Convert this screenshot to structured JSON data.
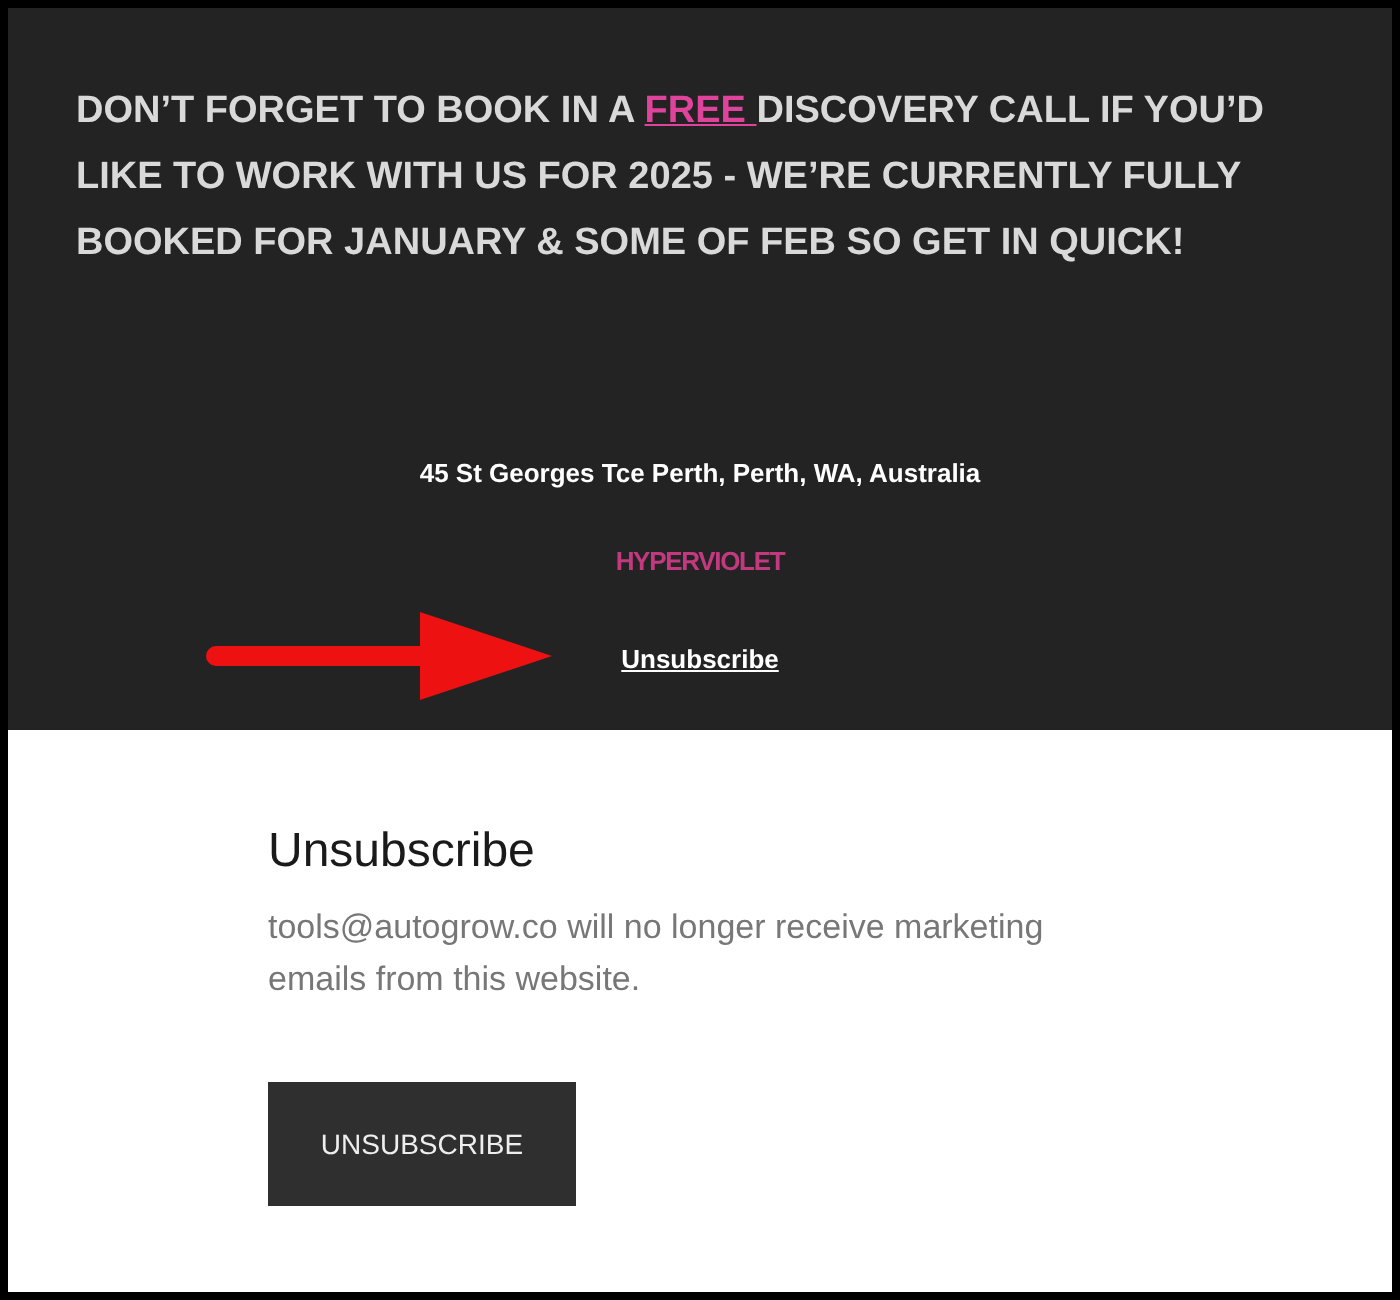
{
  "email_footer": {
    "headline": {
      "before": "DON’T FORGET TO BOOK IN A ",
      "link": "FREE ",
      "after": "DISCOVERY CALL IF YOU’D LIKE TO WORK WITH US FOR 2025 - WE’RE CURRENTLY FULLY BOOKED FOR JANUARY & SOME OF FEB SO GET IN QUICK!"
    },
    "address": "45 St Georges Tce Perth, Perth, WA, Australia",
    "brand": "HYPERVIOLET",
    "unsubscribe_link": "Unsubscribe"
  },
  "unsubscribe_page": {
    "title": "Unsubscribe",
    "message": "tools@autogrow.co will no longer receive marketing emails from this website.",
    "button": "UNSUBSCRIBE"
  }
}
